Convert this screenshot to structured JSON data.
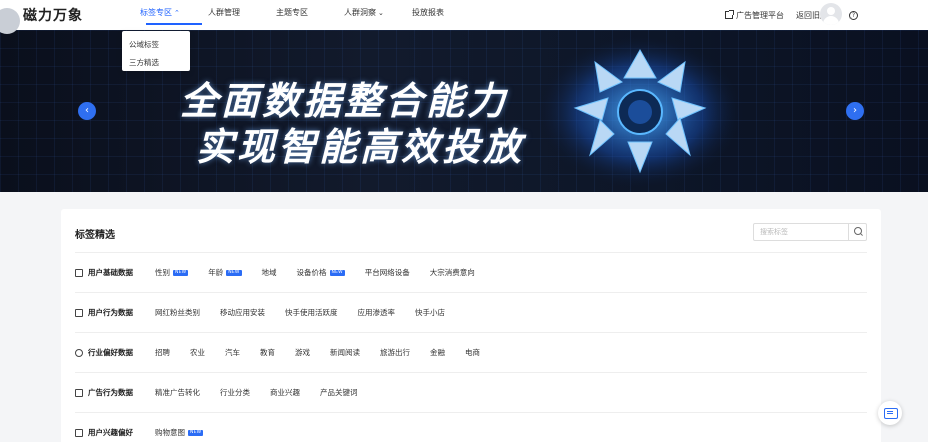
{
  "brand": {
    "name": "磁力万象"
  },
  "nav": {
    "items": [
      {
        "label": "标签专区",
        "active": true,
        "has_dropdown": true
      },
      {
        "label": "人群管理",
        "active": false,
        "has_dropdown": false
      },
      {
        "label": "主题专区",
        "active": false,
        "has_dropdown": false
      },
      {
        "label": "人群洞察",
        "active": false,
        "has_dropdown": true
      },
      {
        "label": "投放报表",
        "active": false,
        "has_dropdown": false
      }
    ],
    "dropdown": [
      "公域标签",
      "三方精选"
    ]
  },
  "header_right": {
    "ad_platform": "广告管理平台",
    "old_version": "返回旧版",
    "help_icon": "help-circle-icon"
  },
  "banner": {
    "line1": "全面数据整合能力",
    "line2": "实现智能高效投放"
  },
  "section": {
    "title": "标签精选",
    "search_placeholder": "搜索标签"
  },
  "badge_label": "NEW",
  "categories": [
    {
      "name": "用户基础数据",
      "icon": "user-card-icon",
      "tags": [
        {
          "label": "性别",
          "new": true
        },
        {
          "label": "年龄",
          "new": true
        },
        {
          "label": "地域",
          "new": false
        },
        {
          "label": "设备价格",
          "new": true
        },
        {
          "label": "平台网络设备",
          "new": false
        },
        {
          "label": "大宗消费意向",
          "new": false
        }
      ]
    },
    {
      "name": "用户行为数据",
      "icon": "behavior-icon",
      "tags": [
        {
          "label": "网红粉丝类别",
          "new": false
        },
        {
          "label": "移动应用安装",
          "new": false
        },
        {
          "label": "快手使用活跃度",
          "new": false
        },
        {
          "label": "应用渗透率",
          "new": false
        },
        {
          "label": "快手小店",
          "new": false
        }
      ]
    },
    {
      "name": "行业偏好数据",
      "icon": "industry-icon",
      "tags": [
        {
          "label": "招聘",
          "new": false
        },
        {
          "label": "农业",
          "new": false
        },
        {
          "label": "汽车",
          "new": false
        },
        {
          "label": "教育",
          "new": false
        },
        {
          "label": "游戏",
          "new": false
        },
        {
          "label": "新闻阅读",
          "new": false
        },
        {
          "label": "旅游出行",
          "new": false
        },
        {
          "label": "金融",
          "new": false
        },
        {
          "label": "电商",
          "new": false
        }
      ]
    },
    {
      "name": "广告行为数据",
      "icon": "ad-behavior-icon",
      "tags": [
        {
          "label": "精准广告转化",
          "new": false
        },
        {
          "label": "行业分类",
          "new": false
        },
        {
          "label": "商业兴趣",
          "new": false
        },
        {
          "label": "产品关键词",
          "new": false
        }
      ]
    },
    {
      "name": "用户兴趣偏好",
      "icon": "interest-icon",
      "tags": [
        {
          "label": "购物意图",
          "new": true
        }
      ]
    }
  ],
  "colors": {
    "accent": "#1f62ff",
    "badge": "#2b6cf5",
    "banner_bg": "#0a0f1c"
  }
}
